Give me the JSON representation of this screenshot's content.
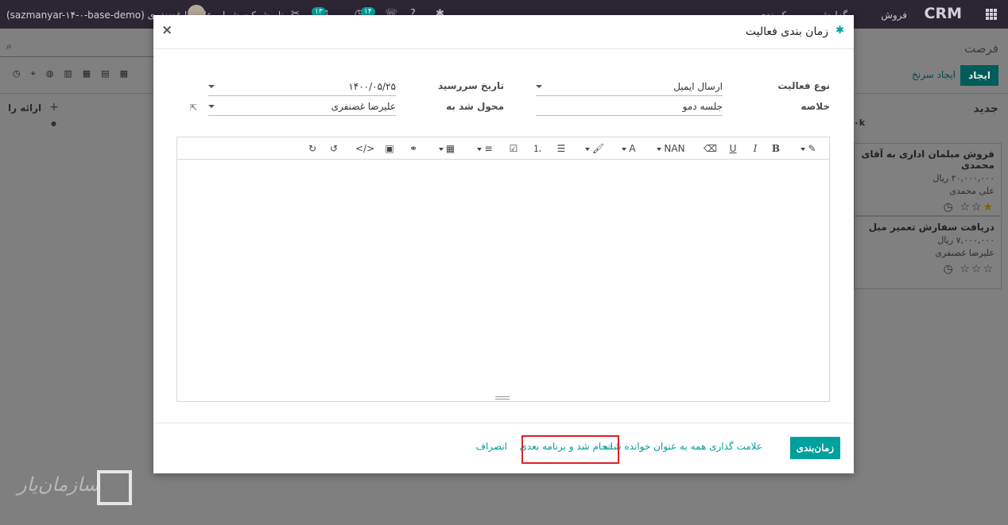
{
  "topbar": {
    "brand": "CRM",
    "menu": [
      "فروش",
      "گزارش",
      "پیکربندی"
    ],
    "badge_activity": "۱۴",
    "badge_messages": "۱۳",
    "user_label": "(sazmanyar-۱۴-۰-base-demo) علیرضا غضنفری",
    "company": "نام شرکت شما"
  },
  "control_panel": {
    "breadcrumb": "فرصت",
    "create_label": "ایجاد",
    "quick_create_label": "ایجاد سرنخ"
  },
  "kanban": {
    "column_new": "جدید",
    "column_left": "ارائه را",
    "column_amount": "۰k",
    "cards": [
      {
        "title": "فروش مبلمان اداری به آقای محمدی",
        "amount": "۲۰,۰۰۰,۰۰۰ ریال",
        "person": "علی محمدی",
        "stars": 1
      },
      {
        "title": "دریافت سفارش تعمیر مبل",
        "amount": "۷,۰۰۰,۰۰۰ ریال",
        "person": "علیرضا غضنفری",
        "stars": 0
      }
    ]
  },
  "modal": {
    "title": "زمان بندی فعالیت",
    "close_glyph": "×",
    "fields": {
      "activity_type_label": "نوع فعالیت",
      "activity_type_value": "ارسال ایمیل",
      "summary_label": "خلاصه",
      "summary_value": "جلسه دمو",
      "due_date_label": "تاریخ سررسید",
      "due_date_value": "۱۴۰۰/۰۵/۲۵",
      "assigned_label": "محول شد به",
      "assigned_value": "علیرضا غضنفری"
    },
    "toolbar": {
      "font_size_label": "NAN"
    },
    "footer": {
      "schedule_label": "زمان‌بندی",
      "mark_read_label": "علامت گذاری همه به عنوان خوانده شده",
      "done_next_label": "انجام شد و برنامه بعدی",
      "cancel_label": "انصراف"
    }
  },
  "watermark": {
    "text": "سازمان‌یار"
  },
  "colors": {
    "accent": "#00a09d",
    "topbar": "#2c2533",
    "highlight": "#e0202b"
  }
}
